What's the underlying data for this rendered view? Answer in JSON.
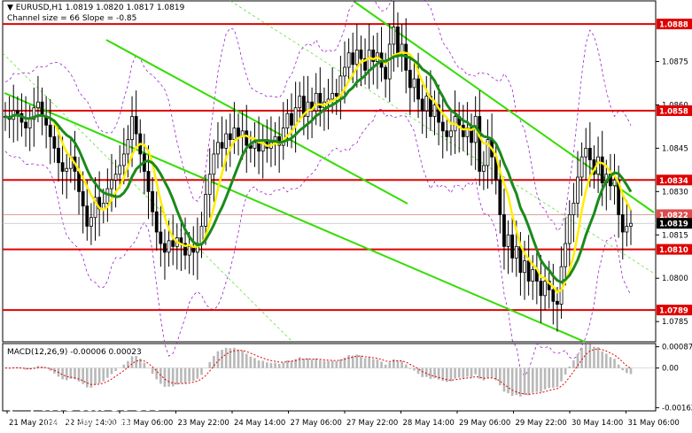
{
  "header": {
    "symbol_line": "EURUSD,H1  1.0819 1.0820 1.0817 1.0819",
    "channel_line": "Channel size = 66 Slope = -0.85",
    "macd_line": "MACD(12,26,9) -0.00006 0.00023"
  },
  "watermark": {
    "brand": "instaforex",
    "tagline": "Instant Forex Trading"
  },
  "colors": {
    "background": "#ffffff",
    "candles": "#000000",
    "level_lines": "#e00000",
    "level_badge": "#e00000",
    "channel": "#33dd00",
    "ma_fast": "#ffee00",
    "ma_slow": "#1a8a1a",
    "bands": "#9922cc",
    "macd_hist": "#b8b8b8",
    "macd_signal": "#e00000"
  },
  "chart_data": {
    "type": "line",
    "title": "EURUSD,H1",
    "x_ticks": [
      "21 May 2024",
      "22 May 14:00",
      "23 May 06:00",
      "23 May 22:00",
      "24 May 14:00",
      "27 May 06:00",
      "27 May 22:00",
      "28 May 14:00",
      "29 May 06:00",
      "29 May 22:00",
      "30 May 14:00",
      "31 May 06:00"
    ],
    "price_axis": {
      "ylim": [
        1.0778,
        1.0896
      ],
      "ticks": [
        1.0875,
        1.086,
        1.0845,
        1.083,
        1.0815,
        1.08,
        1.0785
      ],
      "grid": false
    },
    "levels": [
      {
        "label": "1.0888",
        "value": 1.0888
      },
      {
        "label": "1.0858",
        "value": 1.0858
      },
      {
        "label": "1.0834",
        "value": 1.0834
      },
      {
        "label": "1.0810",
        "value": 1.081
      },
      {
        "label": "1.0789",
        "value": 1.0789
      }
    ],
    "current_price_label": "1.0819",
    "current_price": 1.0819,
    "ask_label": "1.0822",
    "ask_price": 1.0822,
    "close_series": [
      1.0856,
      1.0855,
      1.0858,
      1.0857,
      1.0854,
      1.0852,
      1.0855,
      1.0859,
      1.0861,
      1.0856,
      1.0853,
      1.0849,
      1.0845,
      1.084,
      1.0837,
      1.0838,
      1.0842,
      1.0837,
      1.083,
      1.0825,
      1.0818,
      1.0821,
      1.0828,
      1.0824,
      1.0826,
      1.0831,
      1.0834,
      1.0836,
      1.0839,
      1.0843,
      1.0848,
      1.0856,
      1.085,
      1.0843,
      1.0837,
      1.083,
      1.0823,
      1.0816,
      1.0812,
      1.0809,
      1.0813,
      1.0811,
      1.0814,
      1.0812,
      1.0808,
      1.0811,
      1.0809,
      1.0812,
      1.0818,
      1.0829,
      1.0836,
      1.0843,
      1.0847,
      1.0845,
      1.085,
      1.0848,
      1.0852,
      1.0849,
      1.0851,
      1.0846,
      1.0845,
      1.0847,
      1.0844,
      1.0848,
      1.0845,
      1.0847,
      1.0849,
      1.0846,
      1.0852,
      1.0857,
      1.0853,
      1.0859,
      1.0863,
      1.0856,
      1.0861,
      1.0858,
      1.0864,
      1.0859,
      1.0861,
      1.0862,
      1.0864,
      1.0863,
      1.087,
      1.0873,
      1.0878,
      1.0874,
      1.0879,
      1.0876,
      1.0872,
      1.0879,
      1.0875,
      1.0878,
      1.0873,
      1.0869,
      1.0881,
      1.0887,
      1.0878,
      1.0881,
      1.0872,
      1.0866,
      1.0869,
      1.0862,
      1.0858,
      1.0863,
      1.0856,
      1.086,
      1.0854,
      1.0851,
      1.0849,
      1.0851,
      1.0856,
      1.0853,
      1.0849,
      1.0852,
      1.0847,
      1.0856,
      1.0837,
      1.0839,
      1.0848,
      1.0842,
      1.0834,
      1.0822,
      1.0811,
      1.0815,
      1.0807,
      1.0811,
      1.0802,
      1.0806,
      1.0799,
      1.0803,
      1.0799,
      1.0794,
      1.0799,
      1.0796,
      1.0792,
      1.0791,
      1.0804,
      1.0812,
      1.0822,
      1.0826,
      1.0835,
      1.0842,
      1.0845,
      1.0841,
      1.0836,
      1.0842,
      1.0833,
      1.0836,
      1.0832,
      1.0834,
      1.0822,
      1.0816,
      1.0818,
      1.0819
    ],
    "macd_axis": {
      "ylim": [
        -0.00175,
        0.001
      ],
      "ticks": [
        0.00087,
        0.0,
        -0.00162
      ]
    },
    "series": [
      {
        "name": "MACD(12,26,9)",
        "last": -6e-05
      },
      {
        "name": "Signal",
        "last": 0.00023
      }
    ]
  }
}
